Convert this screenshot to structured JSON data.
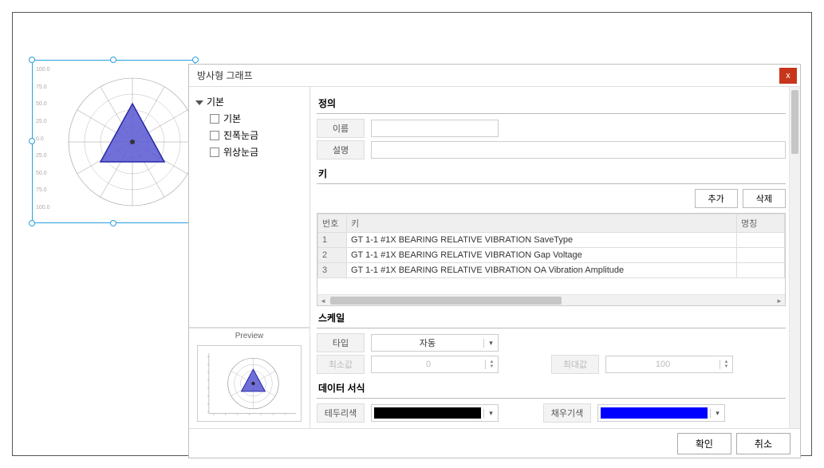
{
  "dialog": {
    "title": "방사형 그래프",
    "close": "x"
  },
  "tree": {
    "root": "기본",
    "items": [
      "기본",
      "진폭눈금",
      "위상눈금"
    ]
  },
  "preview": {
    "label": "Preview"
  },
  "definition": {
    "title": "정의",
    "nameLabel": "이름",
    "nameValue": "",
    "descLabel": "설명",
    "descValue": ""
  },
  "keys": {
    "title": "키",
    "addBtn": "추가",
    "deleteBtn": "삭제",
    "headers": {
      "no": "번호",
      "key": "키",
      "alias": "명칭"
    },
    "rows": [
      {
        "no": "1",
        "key": "GT 1-1 #1X BEARING RELATIVE VIBRATION SaveType",
        "alias": ""
      },
      {
        "no": "2",
        "key": "GT 1-1 #1X BEARING RELATIVE VIBRATION Gap Voltage",
        "alias": ""
      },
      {
        "no": "3",
        "key": "GT 1-1 #1X BEARING RELATIVE VIBRATION OA Vibration Amplitude",
        "alias": ""
      }
    ]
  },
  "scale": {
    "title": "스케일",
    "typeLabel": "타입",
    "typeValue": "자동",
    "minLabel": "최소값",
    "minValue": "0",
    "maxLabel": "최대값",
    "maxValue": "100"
  },
  "format": {
    "title": "데이터 서식",
    "borderLabel": "테두리색",
    "borderColor": "#000000",
    "fillLabel": "채우기색",
    "fillColor": "#0000FF"
  },
  "footer": {
    "ok": "확인",
    "cancel": "취소"
  },
  "bgAxis": [
    "100.0",
    "75.0",
    "50.0",
    "25.0",
    "0.0",
    "25.0",
    "50.0",
    "75.0",
    "100.0"
  ]
}
